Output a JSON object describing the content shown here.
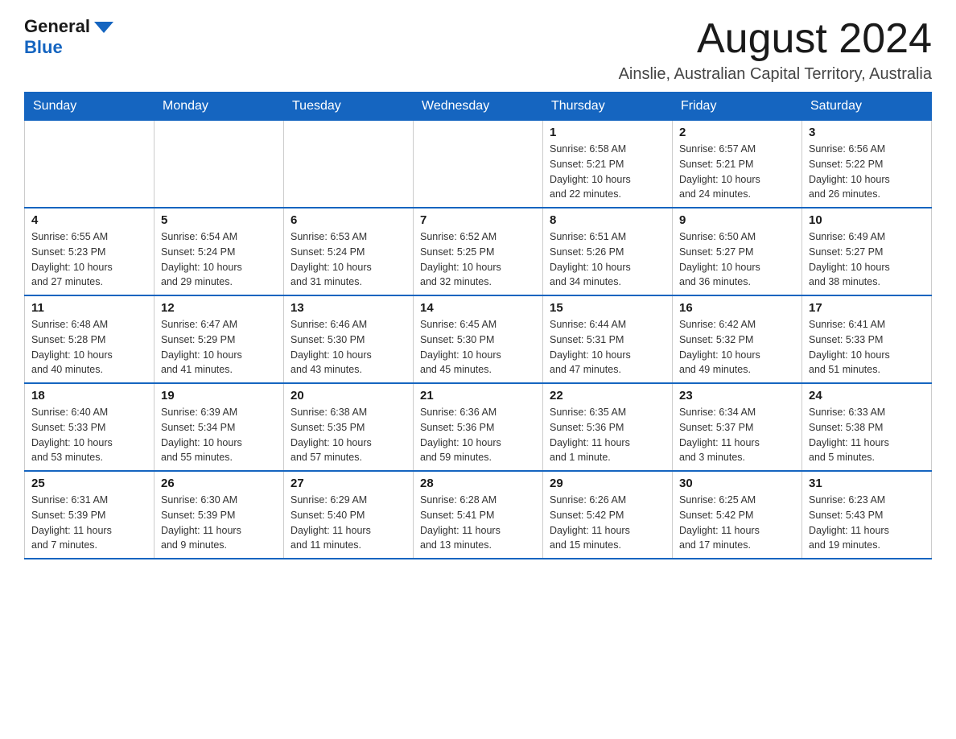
{
  "header": {
    "logo_general": "General",
    "logo_blue": "Blue",
    "month_title": "August 2024",
    "location": "Ainslie, Australian Capital Territory, Australia"
  },
  "days_of_week": [
    "Sunday",
    "Monday",
    "Tuesday",
    "Wednesday",
    "Thursday",
    "Friday",
    "Saturday"
  ],
  "weeks": [
    [
      {
        "day": "",
        "info": ""
      },
      {
        "day": "",
        "info": ""
      },
      {
        "day": "",
        "info": ""
      },
      {
        "day": "",
        "info": ""
      },
      {
        "day": "1",
        "info": "Sunrise: 6:58 AM\nSunset: 5:21 PM\nDaylight: 10 hours\nand 22 minutes."
      },
      {
        "day": "2",
        "info": "Sunrise: 6:57 AM\nSunset: 5:21 PM\nDaylight: 10 hours\nand 24 minutes."
      },
      {
        "day": "3",
        "info": "Sunrise: 6:56 AM\nSunset: 5:22 PM\nDaylight: 10 hours\nand 26 minutes."
      }
    ],
    [
      {
        "day": "4",
        "info": "Sunrise: 6:55 AM\nSunset: 5:23 PM\nDaylight: 10 hours\nand 27 minutes."
      },
      {
        "day": "5",
        "info": "Sunrise: 6:54 AM\nSunset: 5:24 PM\nDaylight: 10 hours\nand 29 minutes."
      },
      {
        "day": "6",
        "info": "Sunrise: 6:53 AM\nSunset: 5:24 PM\nDaylight: 10 hours\nand 31 minutes."
      },
      {
        "day": "7",
        "info": "Sunrise: 6:52 AM\nSunset: 5:25 PM\nDaylight: 10 hours\nand 32 minutes."
      },
      {
        "day": "8",
        "info": "Sunrise: 6:51 AM\nSunset: 5:26 PM\nDaylight: 10 hours\nand 34 minutes."
      },
      {
        "day": "9",
        "info": "Sunrise: 6:50 AM\nSunset: 5:27 PM\nDaylight: 10 hours\nand 36 minutes."
      },
      {
        "day": "10",
        "info": "Sunrise: 6:49 AM\nSunset: 5:27 PM\nDaylight: 10 hours\nand 38 minutes."
      }
    ],
    [
      {
        "day": "11",
        "info": "Sunrise: 6:48 AM\nSunset: 5:28 PM\nDaylight: 10 hours\nand 40 minutes."
      },
      {
        "day": "12",
        "info": "Sunrise: 6:47 AM\nSunset: 5:29 PM\nDaylight: 10 hours\nand 41 minutes."
      },
      {
        "day": "13",
        "info": "Sunrise: 6:46 AM\nSunset: 5:30 PM\nDaylight: 10 hours\nand 43 minutes."
      },
      {
        "day": "14",
        "info": "Sunrise: 6:45 AM\nSunset: 5:30 PM\nDaylight: 10 hours\nand 45 minutes."
      },
      {
        "day": "15",
        "info": "Sunrise: 6:44 AM\nSunset: 5:31 PM\nDaylight: 10 hours\nand 47 minutes."
      },
      {
        "day": "16",
        "info": "Sunrise: 6:42 AM\nSunset: 5:32 PM\nDaylight: 10 hours\nand 49 minutes."
      },
      {
        "day": "17",
        "info": "Sunrise: 6:41 AM\nSunset: 5:33 PM\nDaylight: 10 hours\nand 51 minutes."
      }
    ],
    [
      {
        "day": "18",
        "info": "Sunrise: 6:40 AM\nSunset: 5:33 PM\nDaylight: 10 hours\nand 53 minutes."
      },
      {
        "day": "19",
        "info": "Sunrise: 6:39 AM\nSunset: 5:34 PM\nDaylight: 10 hours\nand 55 minutes."
      },
      {
        "day": "20",
        "info": "Sunrise: 6:38 AM\nSunset: 5:35 PM\nDaylight: 10 hours\nand 57 minutes."
      },
      {
        "day": "21",
        "info": "Sunrise: 6:36 AM\nSunset: 5:36 PM\nDaylight: 10 hours\nand 59 minutes."
      },
      {
        "day": "22",
        "info": "Sunrise: 6:35 AM\nSunset: 5:36 PM\nDaylight: 11 hours\nand 1 minute."
      },
      {
        "day": "23",
        "info": "Sunrise: 6:34 AM\nSunset: 5:37 PM\nDaylight: 11 hours\nand 3 minutes."
      },
      {
        "day": "24",
        "info": "Sunrise: 6:33 AM\nSunset: 5:38 PM\nDaylight: 11 hours\nand 5 minutes."
      }
    ],
    [
      {
        "day": "25",
        "info": "Sunrise: 6:31 AM\nSunset: 5:39 PM\nDaylight: 11 hours\nand 7 minutes."
      },
      {
        "day": "26",
        "info": "Sunrise: 6:30 AM\nSunset: 5:39 PM\nDaylight: 11 hours\nand 9 minutes."
      },
      {
        "day": "27",
        "info": "Sunrise: 6:29 AM\nSunset: 5:40 PM\nDaylight: 11 hours\nand 11 minutes."
      },
      {
        "day": "28",
        "info": "Sunrise: 6:28 AM\nSunset: 5:41 PM\nDaylight: 11 hours\nand 13 minutes."
      },
      {
        "day": "29",
        "info": "Sunrise: 6:26 AM\nSunset: 5:42 PM\nDaylight: 11 hours\nand 15 minutes."
      },
      {
        "day": "30",
        "info": "Sunrise: 6:25 AM\nSunset: 5:42 PM\nDaylight: 11 hours\nand 17 minutes."
      },
      {
        "day": "31",
        "info": "Sunrise: 6:23 AM\nSunset: 5:43 PM\nDaylight: 11 hours\nand 19 minutes."
      }
    ]
  ]
}
